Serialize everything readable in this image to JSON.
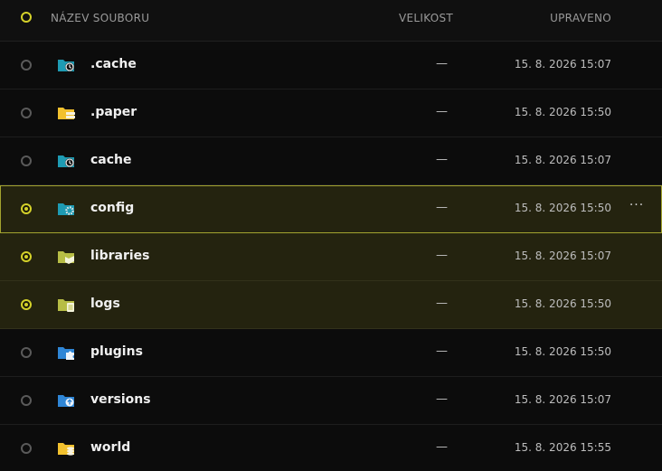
{
  "header": {
    "name_label": "NÁZEV SOUBORU",
    "size_label": "VELIKOST",
    "modified_label": "UPRAVENO"
  },
  "colors": {
    "accent": "#d4d12a",
    "background": "#0c0c0c",
    "selected_row": "#24230f",
    "folder_teal": "#1e9bb3",
    "folder_yellow": "#f2c12e",
    "folder_olive": "#b7bd45",
    "folder_blue": "#2f86d6"
  },
  "rows": [
    {
      "name": ".cache",
      "size": "—",
      "modified": "15. 8. 2026 15:07",
      "icon": "folder-clock-icon",
      "selected": false
    },
    {
      "name": ".paper",
      "size": "—",
      "modified": "15. 8. 2026 15:50",
      "icon": "folder-stack-icon",
      "selected": false
    },
    {
      "name": "cache",
      "size": "—",
      "modified": "15. 8. 2026 15:07",
      "icon": "folder-clock-icon",
      "selected": false
    },
    {
      "name": "config",
      "size": "—",
      "modified": "15. 8. 2026 15:50",
      "icon": "folder-gear-icon",
      "selected": true,
      "more": "···"
    },
    {
      "name": "libraries",
      "size": "—",
      "modified": "15. 8. 2026 15:07",
      "icon": "folder-book-icon",
      "selected": true
    },
    {
      "name": "logs",
      "size": "—",
      "modified": "15. 8. 2026 15:50",
      "icon": "folder-doc-icon",
      "selected": true
    },
    {
      "name": "plugins",
      "size": "—",
      "modified": "15. 8. 2026 15:50",
      "icon": "folder-puzzle-icon",
      "selected": false
    },
    {
      "name": "versions",
      "size": "—",
      "modified": "15. 8. 2026 15:07",
      "icon": "folder-upload-icon",
      "selected": false
    },
    {
      "name": "world",
      "size": "—",
      "modified": "15. 8. 2026 15:55",
      "icon": "folder-coins-icon",
      "selected": false
    }
  ]
}
